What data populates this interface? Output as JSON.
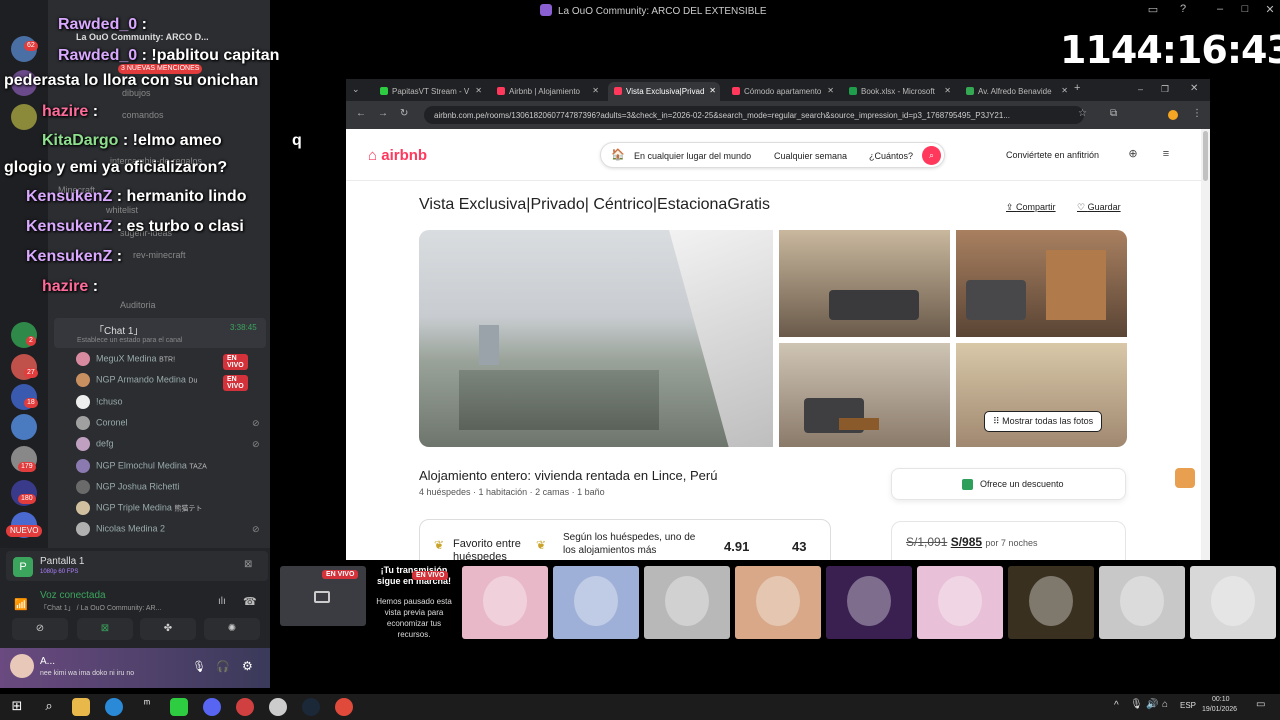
{
  "window": {
    "title": "La OuO Community: ARCO DEL EXTENSIBLE"
  },
  "timer": "1144:16:43",
  "discord": {
    "server_name": "La OuO Community: ARCO D...",
    "mentions_badge": "3 NUEVAS MENCIONES",
    "badges": [
      "62",
      "2",
      "27",
      "18",
      "179",
      "180"
    ],
    "new_label": "NUEVO",
    "channels": [
      "dibujos",
      "comandos",
      "intercambio-de-regalos",
      "Minecraft",
      "whitelist",
      "sugerir-ideas",
      "rev-minecraft",
      "Auditoria"
    ],
    "voice_channel": {
      "name": "「Chat 1」",
      "time": "3:38:45",
      "status_hint": "Establece un estado para el canal"
    },
    "members": [
      {
        "name": "MeguX Medina",
        "extra": "BTR!",
        "live": true
      },
      {
        "name": "NGP Armando Medina",
        "extra": "Du",
        "live": true
      },
      {
        "name": "!chuso",
        "extra": "",
        "live": false
      },
      {
        "name": "Coronel",
        "extra": "",
        "live": false
      },
      {
        "name": "defg",
        "extra": "",
        "live": false
      },
      {
        "name": "NGP Elmochul Medina",
        "extra": "TAZA",
        "live": false
      },
      {
        "name": "NGP Joshua Richetti",
        "extra": "",
        "live": false
      },
      {
        "name": "NGP Triple Medina",
        "extra": "熊猫テト",
        "live": false
      },
      {
        "name": "Nicolas Medina 2",
        "extra": "",
        "live": false
      }
    ],
    "live_label": "EN VIVO",
    "screen_share": {
      "title": "Pantalla 1",
      "sub": "1080p 60 FPS"
    },
    "voice_connected": {
      "title": "Voz conectada",
      "sub": "「Chat 1」 / La OuO Community: AR..."
    },
    "user": {
      "name": "A...",
      "status": "nee kimi wa ima doko ni iru no"
    }
  },
  "chat_messages": [
    {
      "user": "Rawded_0",
      "text": ":"
    },
    {
      "user": "Rawded_0",
      "text": ": !pablitou capitan"
    },
    {
      "user": "",
      "text": "pederasta lo llora con su onichan"
    },
    {
      "user": "hazire",
      "text": ":"
    },
    {
      "user": "KitaDargo",
      "text": ": !elmo ameo"
    },
    {
      "user": "",
      "text": "q"
    },
    {
      "user": "",
      "text": "glogio y emi ya oficializaron?"
    },
    {
      "user": "KensukenZ",
      "text": ": hermanito lindo"
    },
    {
      "user": "KensukenZ",
      "text": ": es turbo o clasi"
    },
    {
      "user": "KensukenZ",
      "text": ":"
    },
    {
      "user": "hazire",
      "text": ":"
    }
  ],
  "browser": {
    "tabs": [
      {
        "label": "PapitasVT Stream - V",
        "color": "#2ecc40",
        "active": false
      },
      {
        "label": "Airbnb | Alojamiento",
        "color": "#ff385c",
        "active": false
      },
      {
        "label": "Vista Exclusiva|Privad",
        "color": "#ff385c",
        "active": true
      },
      {
        "label": "Cómodo apartamento",
        "color": "#ff385c",
        "active": false
      },
      {
        "label": "Book.xlsx - Microsoft",
        "color": "#1e9e4a",
        "active": false
      },
      {
        "label": "Av. Alfredo Benavide",
        "color": "#34a853",
        "active": false
      }
    ],
    "url": "airbnb.com.pe/rooms/1306182060774787396?adults=3&check_in=2026-02-25&search_mode=regular_search&source_impression_id=p3_1768795495_P3JY21..."
  },
  "airbnb": {
    "logo": "airbnb",
    "search": {
      "where": "En cualquier lugar del mundo",
      "when": "Cualquier semana",
      "who": "¿Cuántos?"
    },
    "host_link": "Conviértete en anfitrión",
    "title": "Vista Exclusiva|Privado| Céntrico|EstacionaGratis",
    "share": "Compartir",
    "save": "Guardar",
    "show_all": "Mostrar todas las fotos",
    "stay_title": "Alojamiento entero: vivienda rentada en Lince, Perú",
    "stay_sub": "4 huéspedes · 1 habitación · 2 camas · 1 baño",
    "discount": "Ofrece un descuento",
    "favorite": {
      "label1": "Favorito entre",
      "label2": "huéspedes",
      "desc1": "Según los huéspedes, uno de",
      "desc2": "los alojamientos más",
      "rating": "4.91",
      "reviews": "43"
    },
    "price": {
      "old": "S/1,091",
      "new": "S/985",
      "suffix": "por 7 noches"
    }
  },
  "stream_strip": {
    "paused_title": "¡Tu transmisión sigue en marcha!",
    "paused_text": "Hemos pausado esta vista previa para economizar tus recursos.",
    "live_label": "EN VIVO",
    "tile_colors": [
      "#e8b8c8",
      "#9fb0d8",
      "#b8b8b8",
      "#d8a888",
      "#3a2050",
      "#e8c0d8",
      "#3a3020",
      "#c8c8c8",
      "#d8d8d8"
    ]
  },
  "taskbar": {
    "lang": "ESP",
    "time": "00:10",
    "date": "19/01/2026"
  }
}
